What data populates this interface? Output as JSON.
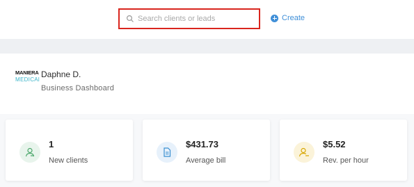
{
  "search": {
    "placeholder": "Search clients or leads",
    "icon": "search-icon"
  },
  "header": {
    "create_label": "Create"
  },
  "profile": {
    "logo_line1": "MANIERA",
    "logo_line2": "MEDICAl",
    "name": "Daphne D.",
    "subtitle": "Business Dashboard"
  },
  "stats": [
    {
      "value": "1",
      "label": "New clients",
      "icon": "user-icon",
      "color": "#4aa66a",
      "bg": "#e8f4ec"
    },
    {
      "value": "$431.73",
      "label": "Average bill",
      "icon": "bill-icon",
      "color": "#3a8fd1",
      "bg": "#e7f1fb"
    },
    {
      "value": "$5.52",
      "label": "Rev. per hour",
      "icon": "user-money-icon",
      "color": "#d7a600",
      "bg": "#fbf3d9"
    }
  ],
  "colors": {
    "accent": "#3f8fd8",
    "highlight": "#d9251d",
    "band": "#eef0f3"
  }
}
